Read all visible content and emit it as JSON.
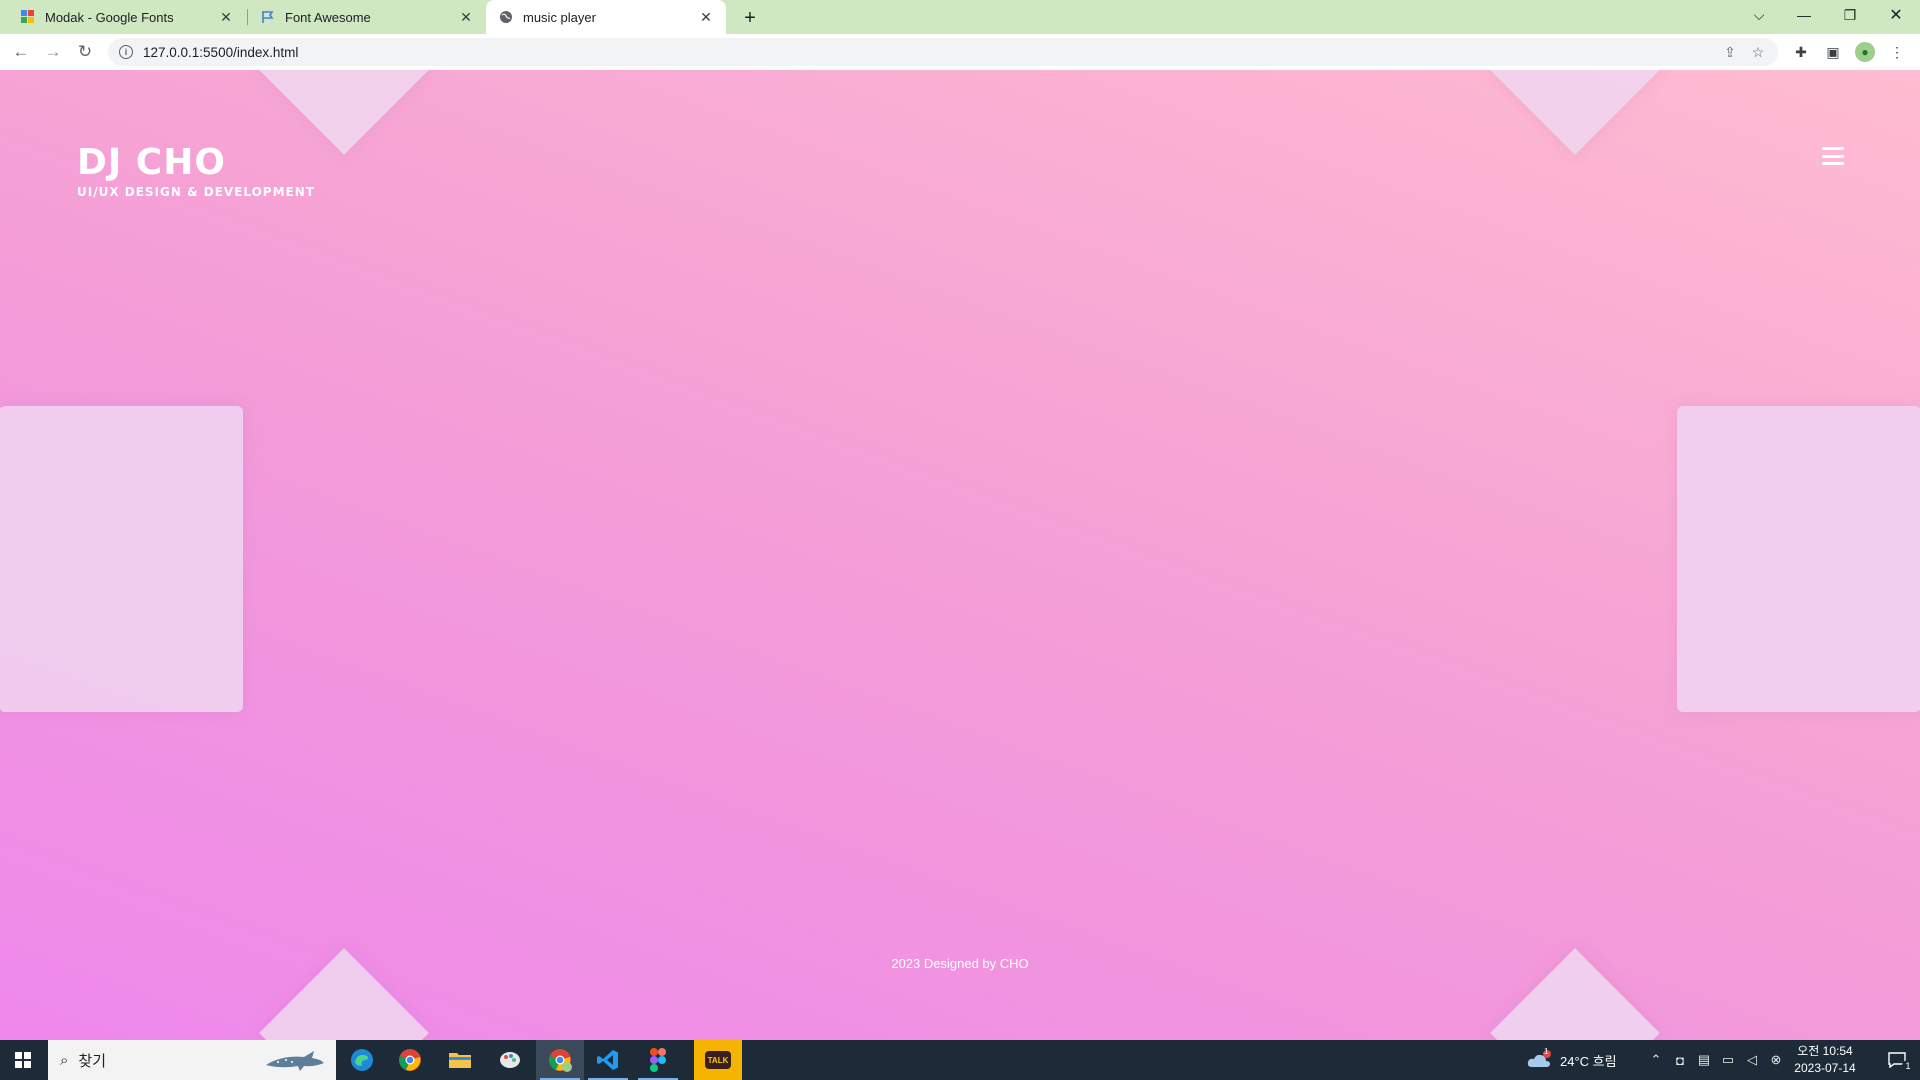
{
  "browser": {
    "tabs": [
      {
        "title": "Modak - Google Fonts",
        "favicon": "google-fonts-icon"
      },
      {
        "title": "Font Awesome",
        "favicon": "flag-icon"
      },
      {
        "title": "music player",
        "favicon": "globe-icon"
      }
    ],
    "active_tab": 2,
    "url": "127.0.0.1:5500/index.html"
  },
  "page": {
    "brand_title": "DJ CHO",
    "brand_subtitle": "UI/UX DESIGN & DEVELOPMENT",
    "footer": "2023 Designed by CHO",
    "gradient_colors": [
      "#ee88ec",
      "#f49ed6",
      "#ffbcd0"
    ],
    "decoration_color": "#f0d7f0"
  },
  "taskbar": {
    "search_placeholder": "찾기",
    "apps": [
      "edge-icon",
      "chrome-icon",
      "file-explorer-icon",
      "paint-icon",
      "chrome-profile-icon",
      "vscode-icon",
      "figma-icon",
      "kakaotalk-icon"
    ],
    "kakao_label": "TALK",
    "weather": "24°C 흐림",
    "weather_badge": "1",
    "time": "오전 10:54",
    "date": "2023-07-14",
    "notification_count": "1"
  }
}
